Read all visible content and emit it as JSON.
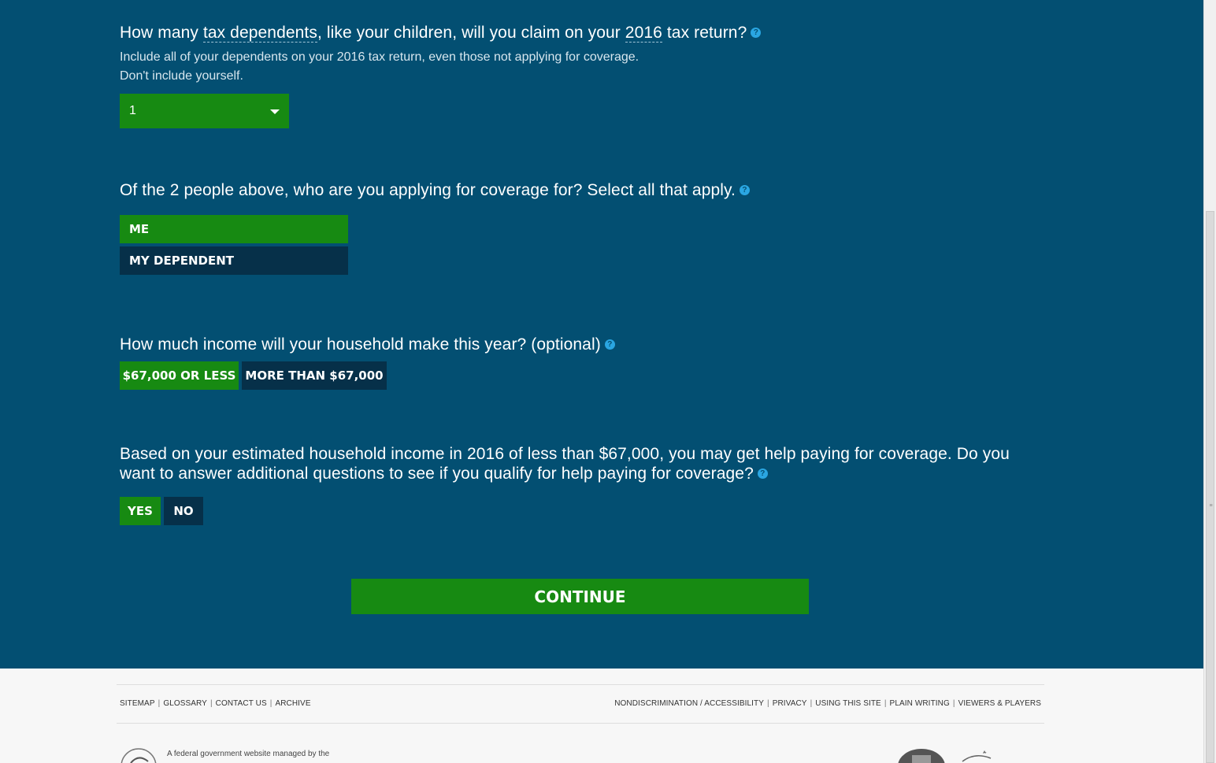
{
  "q1": {
    "prefix": "How many ",
    "term1": "tax dependents",
    "middle": ", like your children, will you claim on your ",
    "term2": "2016",
    "suffix": " tax return?",
    "hint_line1": "Include all of your dependents on your 2016 tax return, even those not applying for coverage.",
    "hint_line2": "Don't include yourself.",
    "select_value": "1"
  },
  "q2": {
    "text": "Of the 2 people above, who are you applying for coverage for? Select all that apply.",
    "options": [
      {
        "label": "ME",
        "selected": true
      },
      {
        "label": "MY DEPENDENT",
        "selected": false
      }
    ]
  },
  "q3": {
    "text": "How much income will your household make this year? (optional)",
    "options": [
      {
        "label": "$67,000 OR LESS",
        "selected": true
      },
      {
        "label": "MORE THAN $67,000",
        "selected": false
      }
    ]
  },
  "q4": {
    "line1": "Based on your estimated household income in 2016 of less than $67,000, you may get help paying for coverage. Do you",
    "line2": "want to answer additional questions to see if you qualify for help paying for coverage?",
    "options": [
      {
        "label": "YES",
        "selected": true
      },
      {
        "label": "NO",
        "selected": false
      }
    ]
  },
  "continue_label": "CONTINUE",
  "help_glyph": "?",
  "footer": {
    "left_links": [
      "SITEMAP",
      "GLOSSARY",
      "CONTACT US",
      "ARCHIVE"
    ],
    "right_links": [
      "NONDISCRIMINATION / ACCESSIBILITY",
      "PRIVACY",
      "USING THIS SITE",
      "PLAIN WRITING",
      "VIEWERS & PLAYERS"
    ],
    "separator": "|",
    "managed_text": "A federal government website managed by the"
  },
  "colors": {
    "background": "#034f72",
    "selected": "#178a12",
    "unselected": "#063049",
    "help_icon": "#2aa6e2"
  }
}
